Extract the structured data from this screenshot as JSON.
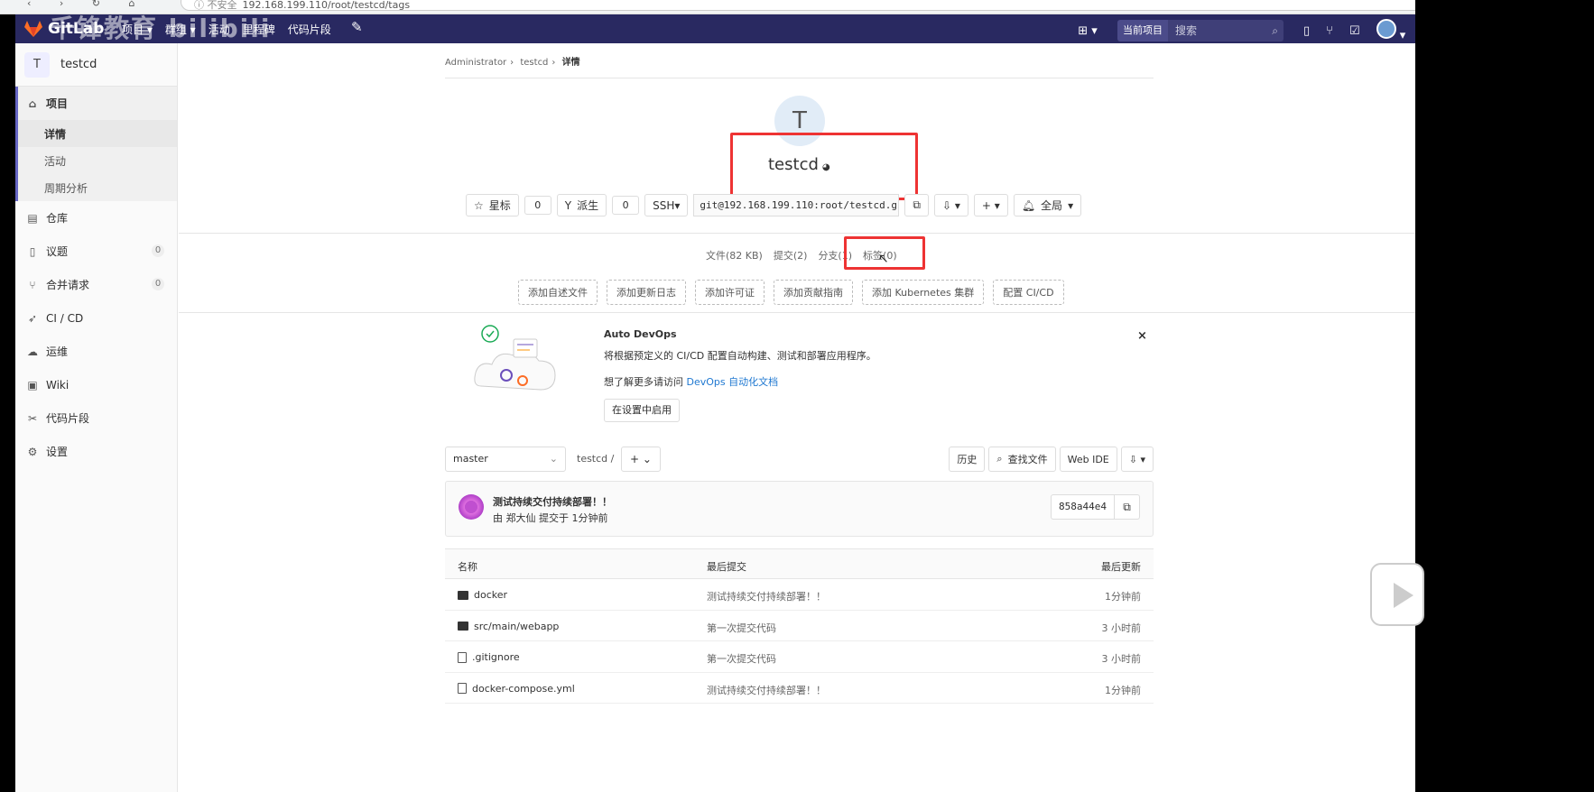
{
  "browser": {
    "url": "192.168.199.110/root/testcd/tags",
    "nav": "‹ › ↻ ⌂",
    "lock": "ⓘ 不安全"
  },
  "header": {
    "brand": "GitLab",
    "watermark": "千锋教育 bilibili",
    "nav": [
      "项目 ▾",
      "群组 ▾",
      "活动",
      "里程碑",
      "代码片段"
    ],
    "current_project": "当前项目",
    "search_placeholder": "搜索"
  },
  "sidebar": {
    "project_initial": "T",
    "project_name": "testcd",
    "group_label": "项目",
    "subs": [
      "详情",
      "活动",
      "周期分析"
    ],
    "items": [
      {
        "label": "仓库",
        "icon": "repo-icon"
      },
      {
        "label": "议题",
        "count": "0",
        "icon": "issues-icon"
      },
      {
        "label": "合并请求",
        "count": "0",
        "icon": "merge-request-icon"
      },
      {
        "label": "CI / CD",
        "icon": "rocket-icon"
      },
      {
        "label": "运维",
        "icon": "cloud-icon"
      },
      {
        "label": "Wiki",
        "icon": "book-icon"
      },
      {
        "label": "代码片段",
        "icon": "scissors-icon"
      },
      {
        "label": "设置",
        "icon": "gear-icon"
      }
    ]
  },
  "breadcrumb": {
    "a": "Administrator",
    "b": "testcd",
    "c": "详情"
  },
  "project": {
    "initial": "T",
    "name": "testcd"
  },
  "actions": {
    "star": "星标",
    "star_count": "0",
    "fork": "派生",
    "fork_count": "0",
    "protocol": "SSH▾",
    "clone_url": "git@192.168.199.110:root/testcd.git",
    "notify": "全局"
  },
  "stats": [
    "文件(82 KB)",
    "提交(2)",
    "分支(1)",
    "标签(0)"
  ],
  "add_links": [
    "添加自述文件",
    "添加更新日志",
    "添加许可证",
    "添加贡献指南",
    "添加 Kubernetes 集群",
    "配置 CI/CD"
  ],
  "devops": {
    "title": "Auto DevOps",
    "desc": "将根据预定义的 CI/CD 配置自动构建、测试和部署应用程序。",
    "more_prefix": "想了解更多请访问 ",
    "more_link": "DevOps 自动化文档",
    "enable": "在设置中启用"
  },
  "toolbar": {
    "branch": "master",
    "path": "testcd  /",
    "history": "历史",
    "find_file": "查找文件",
    "web_ide": "Web IDE"
  },
  "commit": {
    "message": "测试持续交付持续部署！！",
    "meta": "由 郑大仙 提交于 1分钟前",
    "sha": "858a44e4"
  },
  "files": {
    "headers": [
      "名称",
      "最后提交",
      "最后更新"
    ],
    "rows": [
      {
        "name": "docker",
        "type": "folder",
        "commit": "测试持续交付持续部署！！",
        "updated": "1分钟前"
      },
      {
        "name": "src/main/webapp",
        "type": "folder",
        "commit": "第一次提交代码",
        "updated": "3 小时前"
      },
      {
        "name": ".gitignore",
        "type": "file",
        "commit": "第一次提交代码",
        "updated": "3 小时前"
      },
      {
        "name": "docker-compose.yml",
        "type": "file",
        "commit": "测试持续交付持续部署！！",
        "updated": "1分钟前"
      }
    ]
  }
}
